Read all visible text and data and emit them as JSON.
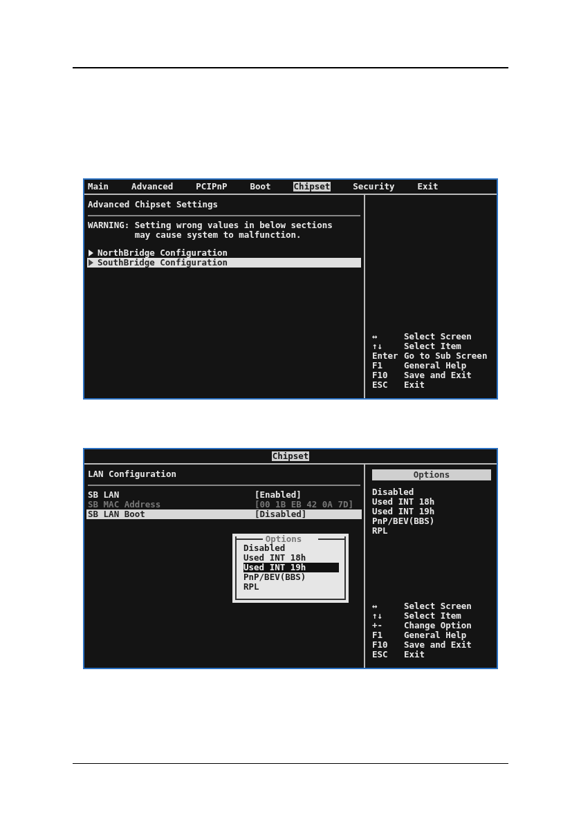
{
  "screens": [
    {
      "menu_bar": [
        {
          "label": "Main",
          "selected": false
        },
        {
          "label": "Advanced",
          "selected": false
        },
        {
          "label": "PCIPnP",
          "selected": false
        },
        {
          "label": "Boot",
          "selected": false
        },
        {
          "label": "Chipset",
          "selected": true
        },
        {
          "label": "Security",
          "selected": false
        },
        {
          "label": "Exit",
          "selected": false
        }
      ],
      "title": "Advanced Chipset Settings",
      "warning": "WARNING: Setting wrong values in below sections\n         may cause system to malfunction.",
      "items": [
        {
          "kind": "submenu",
          "label": "NorthBridge Configuration",
          "selected": false
        },
        {
          "kind": "submenu",
          "label": "SouthBridge Configuration",
          "selected": true
        }
      ],
      "help": [
        {
          "key": "↔",
          "action": "Select Screen"
        },
        {
          "key": "↑↓",
          "action": "Select Item"
        },
        {
          "key": "Enter",
          "action": "Go to Sub Screen"
        },
        {
          "key": "F1",
          "action": "General Help"
        },
        {
          "key": "F10",
          "action": "Save and Exit"
        },
        {
          "key": "ESC",
          "action": "Exit"
        }
      ]
    },
    {
      "menu_bar": [
        {
          "label": "Chipset",
          "selected": true
        }
      ],
      "title": "LAN Configuration",
      "items": [
        {
          "kind": "setting",
          "label": "SB LAN",
          "value": "[Enabled]",
          "disabled": false,
          "selected": false
        },
        {
          "kind": "setting",
          "label": "SB MAC Address",
          "value": "[00 1B EB 42 0A 7D]",
          "disabled": true,
          "selected": false
        },
        {
          "kind": "setting",
          "label": "SB LAN Boot",
          "value": "[Disabled]",
          "disabled": false,
          "selected": true
        }
      ],
      "options_panel": {
        "title": "Options",
        "options": [
          "Disabled",
          "Used INT 18h",
          "Used INT 19h",
          "PnP/BEV(BBS)",
          "RPL"
        ]
      },
      "popup": {
        "title": "Options",
        "options": [
          {
            "label": "Disabled",
            "selected": false
          },
          {
            "label": "Used INT 18h",
            "selected": false
          },
          {
            "label": "Used INT 19h",
            "selected": true
          },
          {
            "label": "PnP/BEV(BBS)",
            "selected": false
          },
          {
            "label": "RPL",
            "selected": false
          }
        ]
      },
      "help": [
        {
          "key": "↔",
          "action": "Select Screen"
        },
        {
          "key": "↑↓",
          "action": "Select Item"
        },
        {
          "key": "+-",
          "action": "Change Option"
        },
        {
          "key": "F1",
          "action": "General Help"
        },
        {
          "key": "F10",
          "action": "Save and Exit"
        },
        {
          "key": "ESC",
          "action": "Exit"
        }
      ]
    }
  ]
}
